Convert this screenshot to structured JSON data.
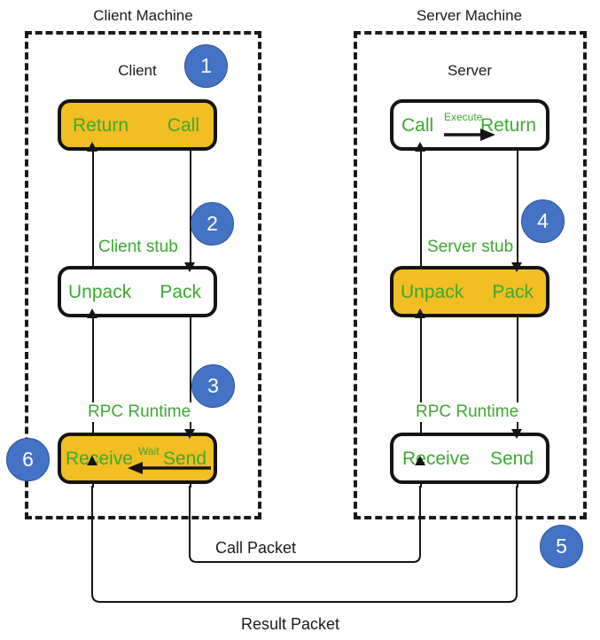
{
  "diagram": {
    "title_client_machine": "Client Machine",
    "title_server_machine": "Server Machine",
    "role_client": "Client",
    "role_server": "Server",
    "colors": {
      "highlight_fill": "#F2BE22",
      "label_green": "#3EA832",
      "badge_blue": "#4472C4",
      "line_black": "#141414"
    }
  },
  "client": {
    "application": {
      "left_label": "Return",
      "right_label": "Call"
    },
    "stub": {
      "caption": "Client stub",
      "left_label": "Unpack",
      "right_label": "Pack"
    },
    "runtime": {
      "caption": "RPC Runtime",
      "left_label": "Receive",
      "right_label": "Send",
      "inner_label": "Wait"
    }
  },
  "server": {
    "application": {
      "left_label": "Call",
      "right_label": "Return",
      "inner_label": "Execute"
    },
    "stub": {
      "caption": "Server stub",
      "left_label": "Unpack",
      "right_label": "Pack"
    },
    "runtime": {
      "caption": "RPC Runtime",
      "left_label": "Receive",
      "right_label": "Send"
    }
  },
  "packets": {
    "call": "Call Packet",
    "result": "Result Packet"
  },
  "badges": [
    {
      "id": "step-1",
      "label": "1"
    },
    {
      "id": "step-2",
      "label": "2"
    },
    {
      "id": "step-3",
      "label": "3"
    },
    {
      "id": "step-4",
      "label": "4"
    },
    {
      "id": "step-5",
      "label": "5"
    },
    {
      "id": "step-6",
      "label": "6"
    }
  ]
}
